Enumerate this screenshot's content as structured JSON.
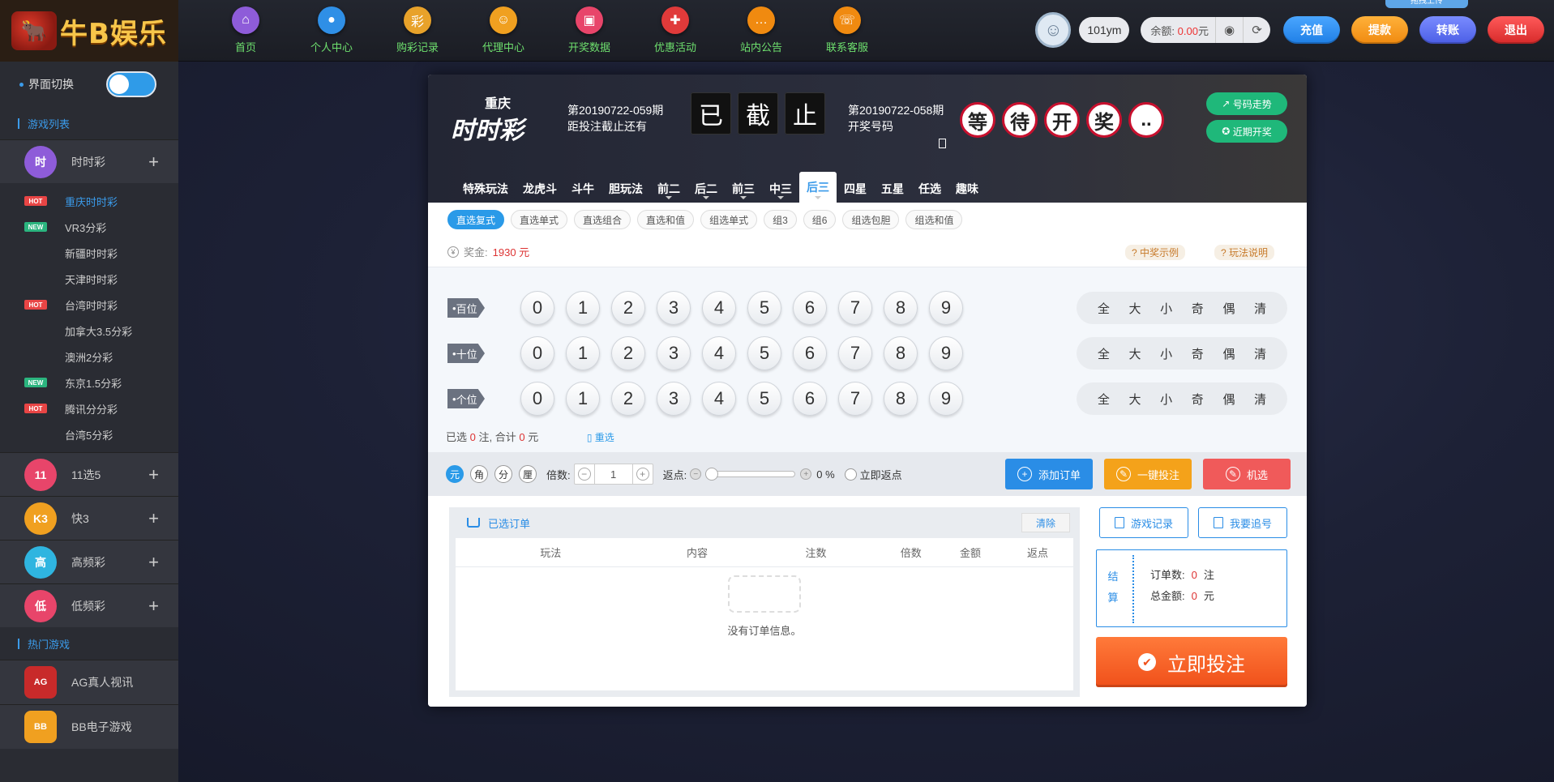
{
  "logo": {
    "text": "牛B娱乐",
    "bull": "🐂"
  },
  "nav": [
    {
      "label": "首页",
      "icon": "home-icon",
      "glyph": "⌂",
      "color": "#8e5cd9"
    },
    {
      "label": "个人中心",
      "icon": "user-icon",
      "glyph": "●",
      "color": "#2f8fe6"
    },
    {
      "label": "购彩记录",
      "icon": "lottery-record-icon",
      "glyph": "彩",
      "color": "#e8a22a"
    },
    {
      "label": "代理中心",
      "icon": "agent-icon",
      "glyph": "☺",
      "color": "#f0a020"
    },
    {
      "label": "开奖数据",
      "icon": "draw-data-icon",
      "glyph": "▣",
      "color": "#e8456a"
    },
    {
      "label": "优惠活动",
      "icon": "gift-icon",
      "glyph": "✚",
      "color": "#e03a3a"
    },
    {
      "label": "站内公告",
      "icon": "notice-icon",
      "glyph": "…",
      "color": "#f08a10"
    },
    {
      "label": "联系客服",
      "icon": "support-icon",
      "glyph": "☏",
      "color": "#f08a10"
    }
  ],
  "user": {
    "name": "101ym",
    "balance_label": "余额:",
    "balance_amount": "0.00",
    "balance_unit": "元",
    "upload_tag": "拖拽上传"
  },
  "top_buttons": {
    "recharge": "充值",
    "withdraw": "提款",
    "transfer": "转账",
    "logout": "退出"
  },
  "sidebar": {
    "switch_label": "界面切换",
    "game_list_title": "游戏列表",
    "hot_games_title": "热门游戏",
    "categories": [
      {
        "label": "时时彩",
        "icon": "ssc-icon",
        "glyph": "时",
        "color": "#8e5cd9"
      },
      {
        "label": "11选5",
        "icon": "11x5-icon",
        "glyph": "11",
        "color": "#e8456a"
      },
      {
        "label": "快3",
        "icon": "k3-icon",
        "glyph": "K3",
        "color": "#f0a020"
      },
      {
        "label": "高频彩",
        "icon": "high-freq-icon",
        "glyph": "高",
        "color": "#2fb5e0"
      },
      {
        "label": "低频彩",
        "icon": "low-freq-icon",
        "glyph": "低",
        "color": "#e8456a"
      }
    ],
    "ssc_items": [
      {
        "label": "重庆时时彩",
        "badge": "HOT",
        "active": true
      },
      {
        "label": "VR3分彩",
        "badge": "NEW"
      },
      {
        "label": "新疆时时彩",
        "badge": ""
      },
      {
        "label": "天津时时彩",
        "badge": ""
      },
      {
        "label": "台湾时时彩",
        "badge": "HOT"
      },
      {
        "label": "加拿大3.5分彩",
        "badge": ""
      },
      {
        "label": "澳洲2分彩",
        "badge": ""
      },
      {
        "label": "东京1.5分彩",
        "badge": "NEW"
      },
      {
        "label": "腾讯分分彩",
        "badge": "HOT"
      },
      {
        "label": "台湾5分彩",
        "badge": ""
      }
    ],
    "hot_games": [
      {
        "label": "AG真人视讯",
        "glyph": "AG",
        "color": "#c82a2a"
      },
      {
        "label": "BB电子游戏",
        "glyph": "BB",
        "color": "#f0a020"
      }
    ]
  },
  "lottery": {
    "name_top": "重庆",
    "name_bottom": "时时彩",
    "current_period": "第20190722-059期",
    "countdown_label": "距投注截止还有",
    "closed_chars": [
      "已",
      "截",
      "止"
    ],
    "last_period": "第20190722-058期",
    "last_label": "开奖号码",
    "draw_chars": [
      "等",
      "待",
      "开",
      "奖",
      ".."
    ],
    "trend_button": "号码走势",
    "recent_button": "近期开奖"
  },
  "tabs": [
    "特殊玩法",
    "龙虎斗",
    "斗牛",
    "胆玩法",
    "前二",
    "后二",
    "前三",
    "中三",
    "后三",
    "四星",
    "五星",
    "任选",
    "趣味"
  ],
  "active_tab": 8,
  "subtabs": [
    "直选复式",
    "直选单式",
    "直选组合",
    "直选和值",
    "组选单式",
    "组3",
    "组6",
    "组选包胆",
    "组选和值"
  ],
  "prize": {
    "label": "奖金:",
    "amount": "1930",
    "unit": "元",
    "example": "中奖示例",
    "rules": "玩法说明"
  },
  "positions": [
    "百位",
    "十位",
    "个位"
  ],
  "digits": [
    "0",
    "1",
    "2",
    "3",
    "4",
    "5",
    "6",
    "7",
    "8",
    "9"
  ],
  "quick_picks": [
    "全",
    "大",
    "小",
    "奇",
    "偶",
    "清"
  ],
  "selection_summary": {
    "prefix": "已选",
    "count": "0",
    "mid": "注, 合计",
    "total": "0",
    "suffix": "元",
    "reset": "重选"
  },
  "bet_bar": {
    "units": [
      "元",
      "角",
      "分",
      "厘"
    ],
    "multiplier_label": "倍数:",
    "multiplier_value": "1",
    "rebate_label": "返点:",
    "rebate_pct": "0 %",
    "instant_rebate": "立即返点",
    "add_order": "添加订单",
    "one_key": "一键投注",
    "random": "机选"
  },
  "orders": {
    "title": "已选订单",
    "clear": "清除",
    "columns": [
      "玩法",
      "内容",
      "注数",
      "倍数",
      "金额",
      "返点"
    ],
    "empty": "没有订单信息。",
    "game_record": "游戏记录",
    "chase": "我要追号",
    "settle_title": "结算",
    "order_count_label": "订单数:",
    "order_count": "0",
    "order_count_unit": "注",
    "total_label": "总金额:",
    "total_amount": "0",
    "total_unit": "元",
    "bet_now": "立即投注"
  }
}
